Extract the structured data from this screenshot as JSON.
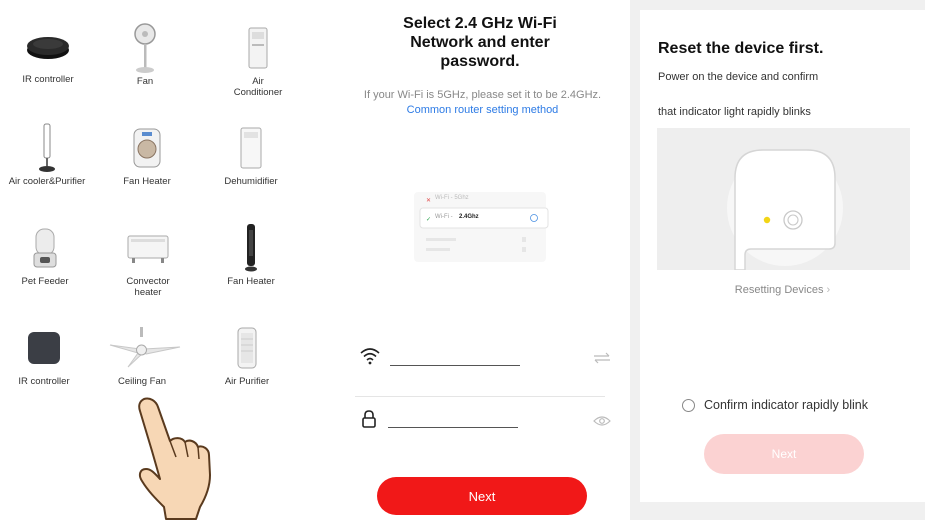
{
  "devices": [
    {
      "label": "IR controller",
      "icon": "ir-controller-icon"
    },
    {
      "label": "Fan",
      "icon": "fan-icon"
    },
    {
      "label": "Air\nConditioner",
      "icon": "air-conditioner-icon"
    },
    {
      "label": "Air cooler&Purifier",
      "icon": "air-cooler-icon"
    },
    {
      "label": "Fan Heater",
      "icon": "fan-heater-icon"
    },
    {
      "label": "Dehumidifier",
      "icon": "dehumidifier-icon"
    },
    {
      "label": "Pet Feeder",
      "icon": "pet-feeder-icon"
    },
    {
      "label": "Convector\nheater",
      "icon": "convector-heater-icon"
    },
    {
      "label": "Fan Heater",
      "icon": "tower-heater-icon"
    },
    {
      "label": "IR controller",
      "icon": "ir-hub-icon"
    },
    {
      "label": "Ceiling Fan",
      "icon": "ceiling-fan-icon"
    },
    {
      "label": "Air Purifier",
      "icon": "air-purifier-icon"
    }
  ],
  "wifi": {
    "title": "Select 2.4 GHz Wi-Fi\nNetwork and enter\npassword.",
    "hint": "If your Wi-Fi is 5GHz, please set it to be 2.4GHz.",
    "hint_link": "Common router setting method",
    "card_row1": "Wi-Fi - 5Ghz",
    "card_row2_prefix": "Wi-Fi - ",
    "card_row2_band": "2.4Ghz",
    "ssid_value": "",
    "password_value": "",
    "next_label": "Next"
  },
  "reset": {
    "title": "Reset the device first.",
    "line1": "Power on the device and confirm",
    "line2": "that indicator light rapidly blinks",
    "link": "Resetting Devices",
    "confirm_label": "Confirm indicator rapidly blink",
    "next_label": "Next"
  },
  "colors": {
    "accent_red": "#f11818",
    "disabled_red": "#fbd2d2",
    "link_blue": "#2d7be5",
    "indicator_yellow": "#f2d516"
  }
}
